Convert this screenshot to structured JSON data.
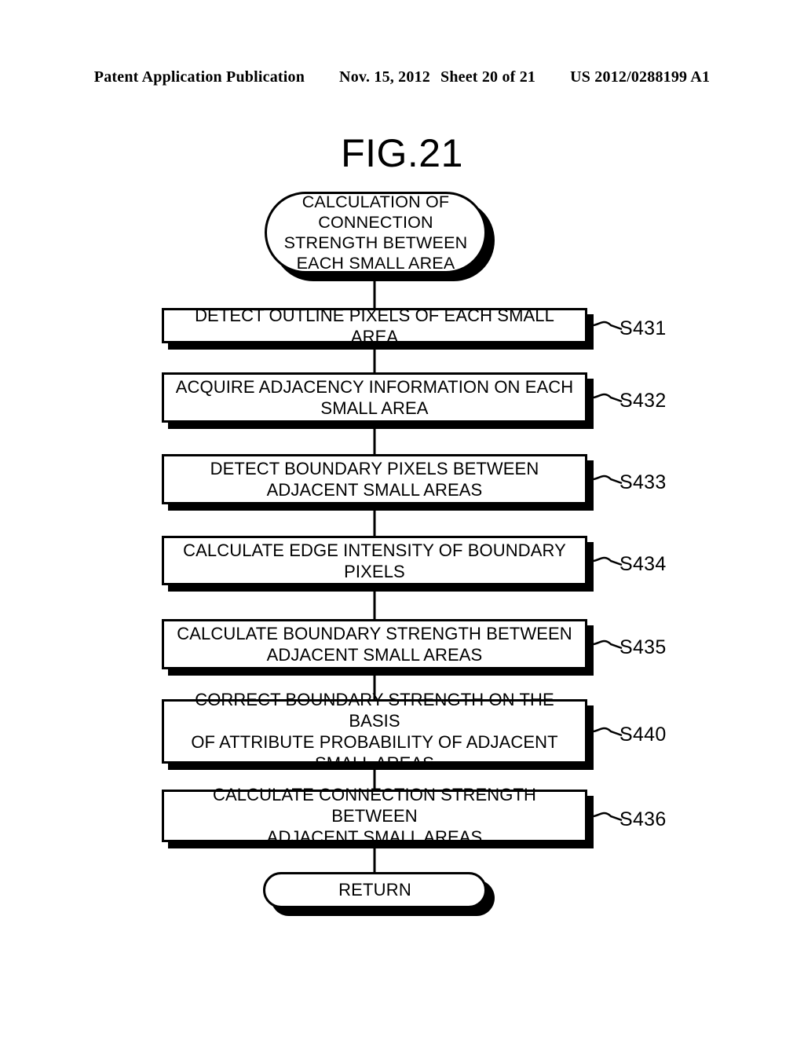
{
  "header": {
    "publication": "Patent Application Publication",
    "date": "Nov. 15, 2012",
    "sheet": "Sheet 20 of 21",
    "number": "US 2012/0288199 A1"
  },
  "figure": {
    "title": "FIG.21"
  },
  "flowchart": {
    "start": {
      "label": "CALCULATION OF CONNECTION STRENGTH BETWEEN EACH SMALL AREA",
      "lines": [
        "CALCULATION OF",
        "CONNECTION",
        "STRENGTH BETWEEN",
        "EACH SMALL AREA"
      ]
    },
    "end": {
      "label": "RETURN"
    },
    "steps": [
      {
        "id": "S431",
        "text": "DETECT OUTLINE PIXELS OF EACH SMALL AREA",
        "lines": [
          "DETECT OUTLINE PIXELS OF EACH SMALL AREA"
        ]
      },
      {
        "id": "S432",
        "text": "ACQUIRE ADJACENCY INFORMATION ON EACH SMALL AREA",
        "lines": [
          "ACQUIRE ADJACENCY INFORMATION ON EACH",
          "SMALL AREA"
        ]
      },
      {
        "id": "S433",
        "text": "DETECT BOUNDARY PIXELS BETWEEN ADJACENT SMALL AREAS",
        "lines": [
          "DETECT BOUNDARY PIXELS BETWEEN",
          "ADJACENT SMALL AREAS"
        ]
      },
      {
        "id": "S434",
        "text": "CALCULATE EDGE INTENSITY OF BOUNDARY PIXELS",
        "lines": [
          "CALCULATE EDGE INTENSITY OF BOUNDARY",
          "PIXELS"
        ]
      },
      {
        "id": "S435",
        "text": "CALCULATE BOUNDARY STRENGTH BETWEEN ADJACENT SMALL AREAS",
        "lines": [
          "CALCULATE BOUNDARY STRENGTH BETWEEN",
          "ADJACENT SMALL AREAS"
        ]
      },
      {
        "id": "S440",
        "text": "CORRECT BOUNDARY STRENGTH ON THE BASIS OF ATTRIBUTE PROBABILITY OF ADJACENT SMALL AREAS",
        "lines": [
          "CORRECT BOUNDARY STRENGTH ON THE BASIS",
          "OF ATTRIBUTE PROBABILITY OF ADJACENT",
          "SMALL AREAS"
        ]
      },
      {
        "id": "S436",
        "text": "CALCULATE CONNECTION STRENGTH BETWEEN ADJACENT SMALL AREAS",
        "lines": [
          "CALCULATE CONNECTION STRENGTH BETWEEN",
          "ADJACENT SMALL AREAS"
        ]
      }
    ]
  },
  "colors": {
    "ink": "#000000",
    "paper": "#ffffff"
  }
}
